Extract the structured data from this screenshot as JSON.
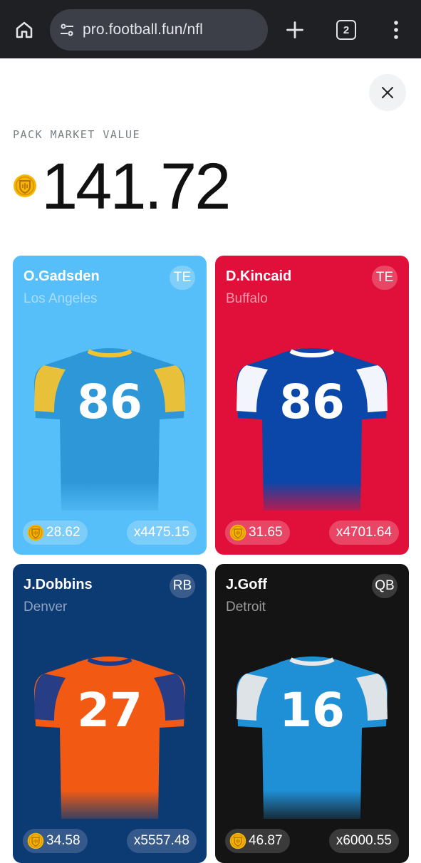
{
  "browser": {
    "url": "pro.football.fun/nfl",
    "tab_count": "2",
    "icons": [
      "home-icon",
      "site-settings-icon",
      "new-tab-plus-icon",
      "tab-switcher-icon",
      "more-menu-icon"
    ]
  },
  "pack": {
    "label": "PACK MARKET VALUE",
    "value": "141.72",
    "close_icon": "close-icon"
  },
  "cards": [
    {
      "name": "O.Gadsden",
      "team": "Los Angeles",
      "position": "TE",
      "price": "28.62",
      "multiplier": "x4475.15",
      "number": "86",
      "colors": {
        "bg": "#56bff9",
        "team_text": "#a9dcfb",
        "jersey": "#2e97d8",
        "shoulder": "#f2c230",
        "number": "#ffffff",
        "badge_bg": "#7fcffa",
        "pill_bg": "#7ccdf9",
        "text": "#ffffff"
      }
    },
    {
      "name": "D.Kincaid",
      "team": "Buffalo",
      "position": "TE",
      "price": "31.65",
      "multiplier": "x4701.64",
      "number": "86",
      "colors": {
        "bg": "#e0103a",
        "team_text": "#f39aab",
        "jersey": "#0b47a8",
        "shoulder": "#ffffff",
        "number": "#ffffff",
        "badge_bg": "#e94665",
        "pill_bg": "#e94665",
        "text": "#ffffff"
      }
    },
    {
      "name": "J.Dobbins",
      "team": "Denver",
      "position": "RB",
      "price": "34.58",
      "multiplier": "x5557.48",
      "number": "27",
      "colors": {
        "bg": "#0c3a73",
        "team_text": "#8ea3c2",
        "jersey": "#f25a14",
        "shoulder": "#1b3c8c",
        "number": "#ffffff",
        "badge_bg": "#3a5c8b",
        "pill_bg": "#36598b",
        "text": "#ffffff"
      }
    },
    {
      "name": "J.Goff",
      "team": "Detroit",
      "position": "QB",
      "price": "46.87",
      "multiplier": "x6000.55",
      "number": "16",
      "colors": {
        "bg": "#141414",
        "team_text": "#9a9a9a",
        "jersey": "#1f8fd6",
        "shoulder": "#e8e8e8",
        "number": "#ffffff",
        "badge_bg": "#3a3a3a",
        "pill_bg": "#3a3a3a",
        "text": "#ffffff"
      }
    }
  ]
}
